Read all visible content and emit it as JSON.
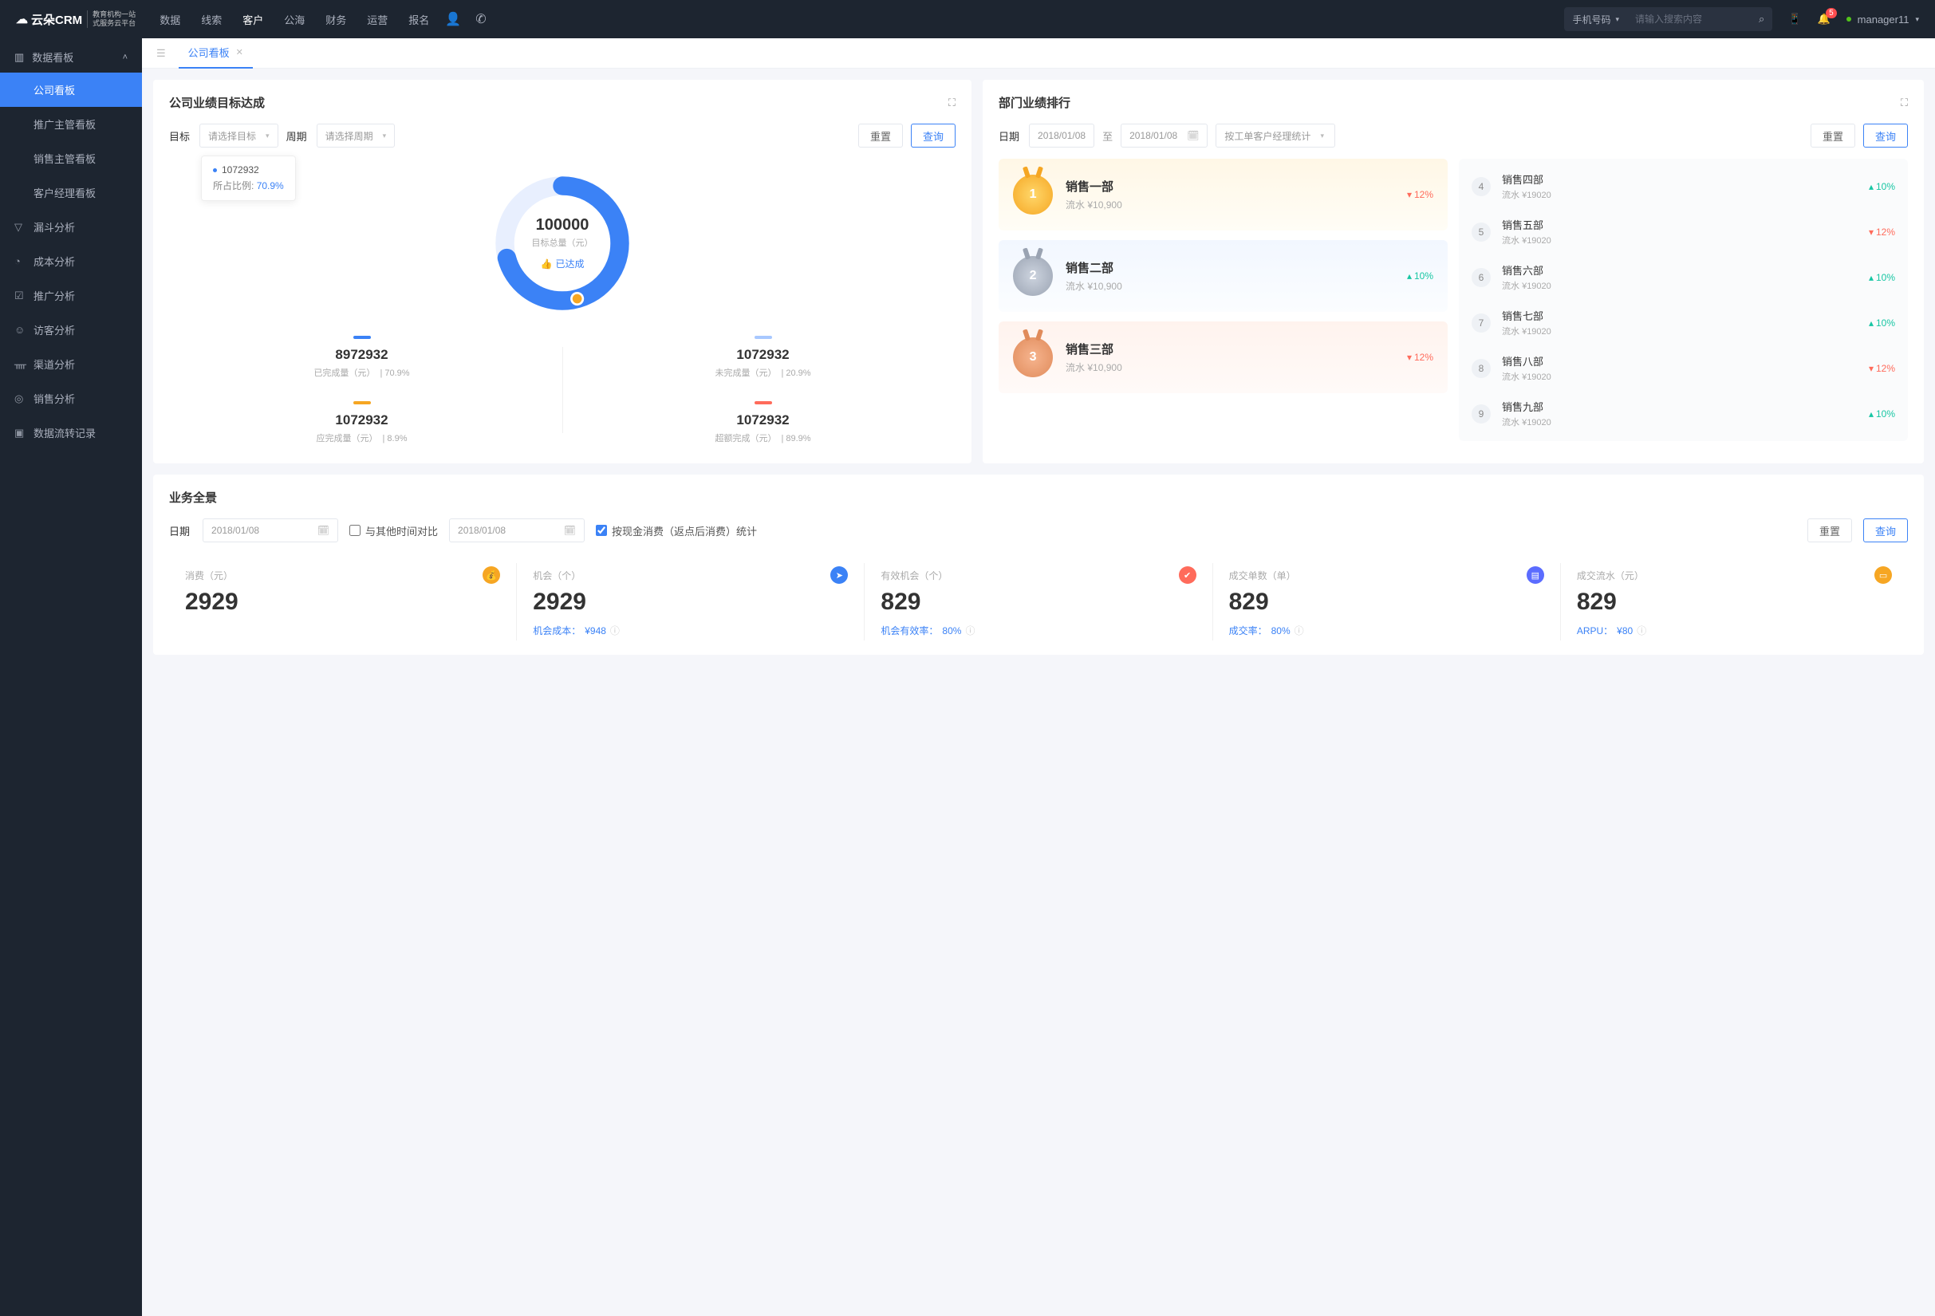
{
  "header": {
    "logo_brand": "云朵CRM",
    "logo_sub1": "教育机构一站",
    "logo_sub2": "式服务云平台",
    "nav": [
      "数据",
      "线索",
      "客户",
      "公海",
      "财务",
      "运营",
      "报名"
    ],
    "nav_active": 2,
    "search_type": "手机号码",
    "search_placeholder": "请输入搜索内容",
    "bell_badge": "5",
    "user": "manager11"
  },
  "sidebar": {
    "group": "数据看板",
    "items": [
      "公司看板",
      "推广主管看板",
      "销售主管看板",
      "客户经理看板"
    ],
    "active": 0,
    "sections": [
      "漏斗分析",
      "成本分析",
      "推广分析",
      "访客分析",
      "渠道分析",
      "销售分析",
      "数据流转记录"
    ]
  },
  "tab": {
    "title": "公司看板"
  },
  "goal": {
    "title": "公司业绩目标达成",
    "label_target": "目标",
    "sel_target": "请选择目标",
    "label_period": "周期",
    "sel_period": "请选择周期",
    "btn_reset": "重置",
    "btn_query": "查询",
    "tip_value": "1072932",
    "tip_label": "所占比例:",
    "tip_pct": "70.9%",
    "gauge_value": "100000",
    "gauge_label": "目标总量（元）",
    "gauge_badge": "已达成",
    "metrics": [
      {
        "value": "8972932",
        "label": "已完成量（元）",
        "pct": "70.9%"
      },
      {
        "value": "1072932",
        "label": "未完成量（元）",
        "pct": "20.9%"
      },
      {
        "value": "1072932",
        "label": "应完成量（元）",
        "pct": "8.9%"
      },
      {
        "value": "1072932",
        "label": "超额完成（元）",
        "pct": "89.9%"
      }
    ]
  },
  "rank": {
    "title": "部门业绩排行",
    "label_date": "日期",
    "date_from": "2018/01/08",
    "date_to": "2018/01/08",
    "date_sep": "至",
    "sel_stat": "按工单客户经理统计",
    "btn_reset": "重置",
    "btn_query": "查询",
    "top": [
      {
        "rank": "1",
        "name": "销售一部",
        "sub": "流水 ¥10,900",
        "trend": "12%",
        "dir": "down"
      },
      {
        "rank": "2",
        "name": "销售二部",
        "sub": "流水 ¥10,900",
        "trend": "10%",
        "dir": "up"
      },
      {
        "rank": "3",
        "name": "销售三部",
        "sub": "流水 ¥10,900",
        "trend": "12%",
        "dir": "down"
      }
    ],
    "list": [
      {
        "rank": "4",
        "name": "销售四部",
        "sub": "流水 ¥19020",
        "trend": "10%",
        "dir": "up"
      },
      {
        "rank": "5",
        "name": "销售五部",
        "sub": "流水 ¥19020",
        "trend": "12%",
        "dir": "down"
      },
      {
        "rank": "6",
        "name": "销售六部",
        "sub": "流水 ¥19020",
        "trend": "10%",
        "dir": "up"
      },
      {
        "rank": "7",
        "name": "销售七部",
        "sub": "流水 ¥19020",
        "trend": "10%",
        "dir": "up"
      },
      {
        "rank": "8",
        "name": "销售八部",
        "sub": "流水 ¥19020",
        "trend": "12%",
        "dir": "down"
      },
      {
        "rank": "9",
        "name": "销售九部",
        "sub": "流水 ¥19020",
        "trend": "10%",
        "dir": "up"
      }
    ]
  },
  "pano": {
    "title": "业务全景",
    "label_date": "日期",
    "date1": "2018/01/08",
    "chk_compare": "与其他时间对比",
    "date2": "2018/01/08",
    "chk_cash": "按现金消费（返点后消费）统计",
    "btn_reset": "重置",
    "btn_query": "查询",
    "kpis": [
      {
        "label": "消费（元）",
        "value": "2929",
        "sub": "",
        "subval": ""
      },
      {
        "label": "机会（个）",
        "value": "2929",
        "sub": "机会成本：",
        "subval": "¥948"
      },
      {
        "label": "有效机会（个）",
        "value": "829",
        "sub": "机会有效率：",
        "subval": "80%"
      },
      {
        "label": "成交单数（单）",
        "value": "829",
        "sub": "成交率：",
        "subval": "80%"
      },
      {
        "label": "成交流水（元）",
        "value": "829",
        "sub": "ARPU：",
        "subval": "¥80"
      }
    ]
  },
  "chart_data": {
    "type": "pie",
    "title": "目标总量（元）",
    "total": 100000,
    "series": [
      {
        "name": "已完成量（元）",
        "value": 8972932,
        "pct": 70.9
      },
      {
        "name": "未完成量（元）",
        "value": 1072932,
        "pct": 20.9
      },
      {
        "name": "应完成量（元）",
        "value": 1072932,
        "pct": 8.9
      },
      {
        "name": "超额完成（元）",
        "value": 1072932,
        "pct": 89.9
      }
    ]
  }
}
